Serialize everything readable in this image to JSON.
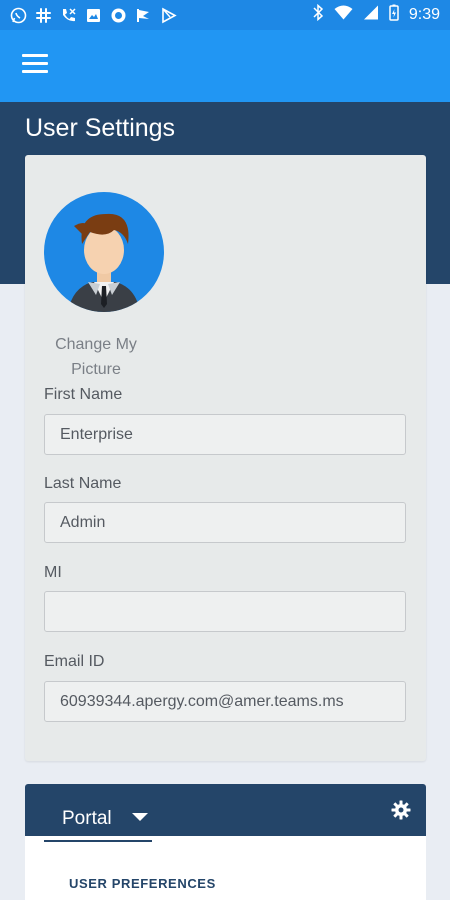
{
  "status_bar": {
    "time": "9:39",
    "left_icons": [
      "whatsapp-icon",
      "slack-icon",
      "wifi-call-icon",
      "gallery-icon",
      "circle-app-icon",
      "flag-icon",
      "play-store-icon"
    ],
    "right_icons": [
      "bluetooth-icon",
      "wifi-icon",
      "signal-icon",
      "battery-icon"
    ]
  },
  "app_bar": {
    "menu_icon": "hamburger-menu-icon"
  },
  "page": {
    "title": "User Settings"
  },
  "profile": {
    "change_picture_label": "Change My Picture",
    "fields": {
      "first_name": {
        "label": "First Name",
        "value": "Enterprise"
      },
      "last_name": {
        "label": "Last Name",
        "value": "Admin"
      },
      "mi": {
        "label": "MI",
        "value": ""
      },
      "email": {
        "label": "Email ID",
        "value": "60939344.apergy.com@amer.teams.ms"
      }
    }
  },
  "portal": {
    "tab_label": "Portal",
    "section_title": "USER PREFERENCES",
    "settings_icon": "gear-icon"
  },
  "colors": {
    "status_bar": "#1e88e5",
    "app_bar": "#2196f3",
    "header_band": "#244569",
    "background": "#e9edf3",
    "card": "#e7eaea"
  }
}
